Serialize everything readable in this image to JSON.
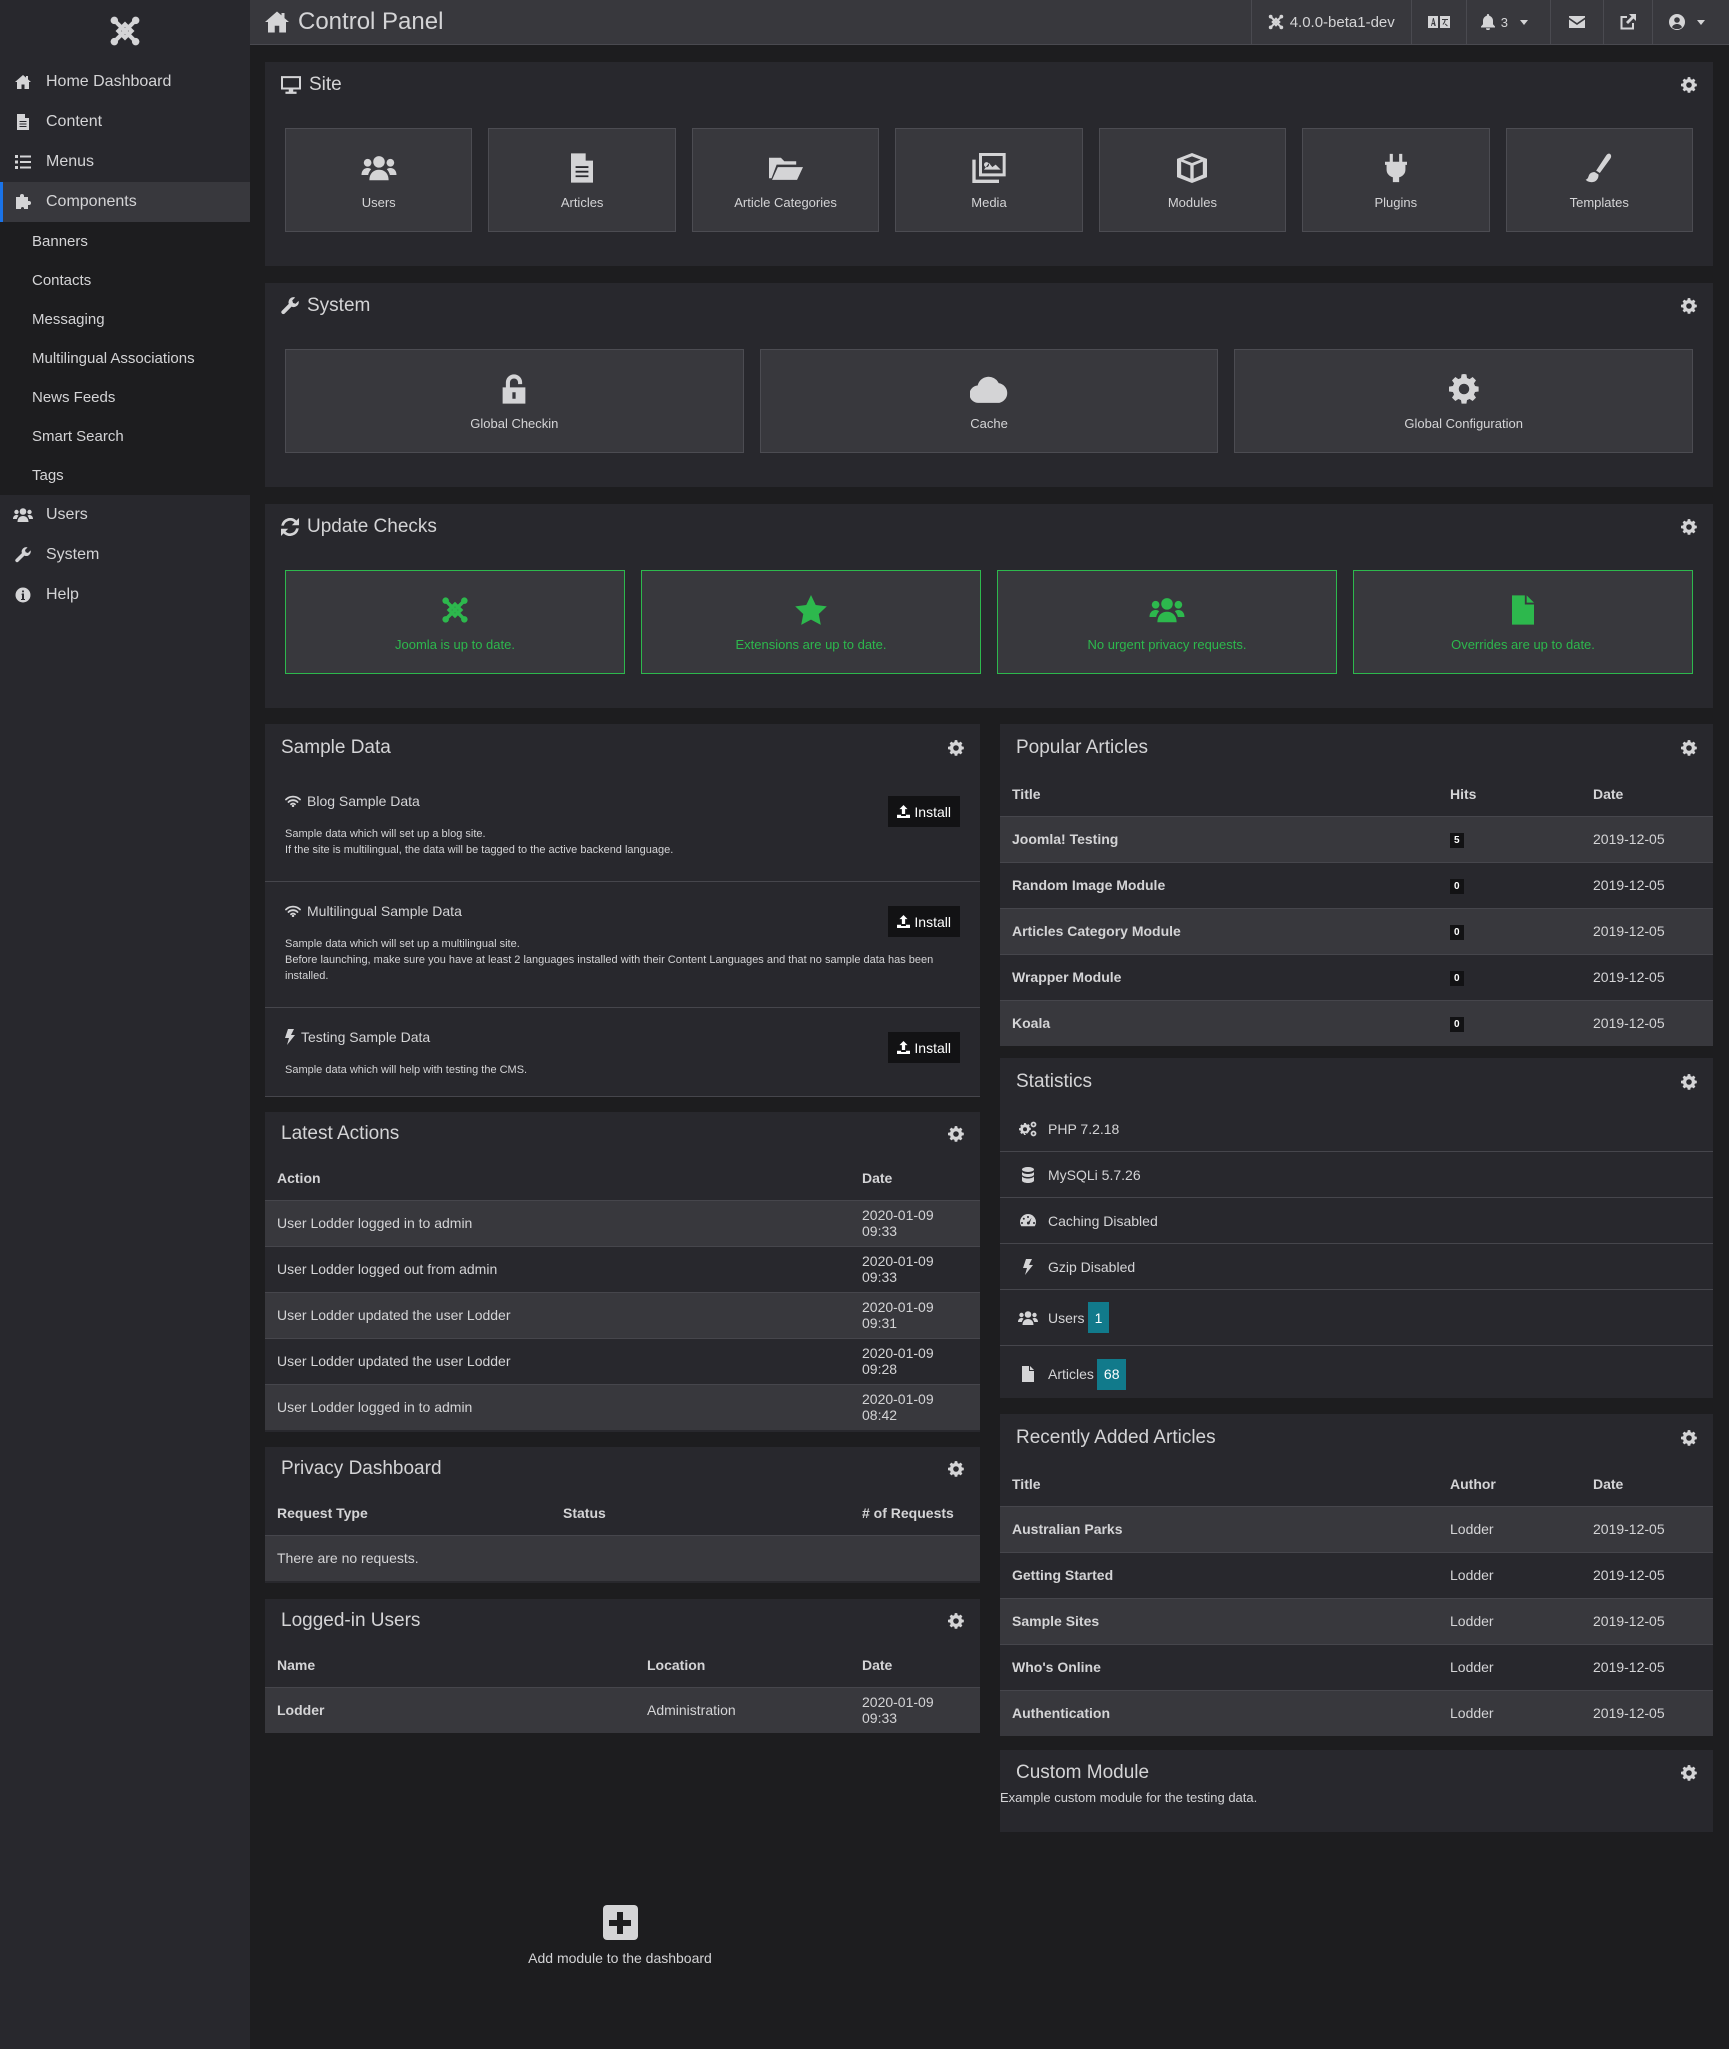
{
  "header": {
    "title": "Control Panel",
    "version": "4.0.0-beta1-dev",
    "notifications_count": "3"
  },
  "sidebar": {
    "items": [
      {
        "label": "Home Dashboard",
        "icon": "home-icon"
      },
      {
        "label": "Content",
        "icon": "file-icon"
      },
      {
        "label": "Menus",
        "icon": "list-icon"
      },
      {
        "label": "Components",
        "icon": "puzzle-icon",
        "active": true
      },
      {
        "label": "Users",
        "icon": "users-icon"
      },
      {
        "label": "System",
        "icon": "wrench-icon"
      },
      {
        "label": "Help",
        "icon": "info-icon"
      }
    ],
    "components_submenu": [
      "Banners",
      "Contacts",
      "Messaging",
      "Multilingual Associations",
      "News Feeds",
      "Smart Search",
      "Tags"
    ]
  },
  "site": {
    "title": "Site",
    "tiles": [
      "Users",
      "Articles",
      "Article Categories",
      "Media",
      "Modules",
      "Plugins",
      "Templates"
    ]
  },
  "system": {
    "title": "System",
    "tiles": [
      "Global Checkin",
      "Cache",
      "Global Configuration"
    ]
  },
  "update_checks": {
    "title": "Update Checks",
    "tiles": [
      "Joomla is up to date.",
      "Extensions are up to date.",
      "No urgent privacy requests.",
      "Overrides are up to date."
    ],
    "status_color": "#2db84d"
  },
  "sample_data": {
    "title": "Sample Data",
    "install_label": "Install",
    "items": [
      {
        "title": "Blog Sample Data",
        "desc": [
          "Sample data which will set up a blog site.",
          "If the site is multilingual, the data will be tagged to the active backend language."
        ]
      },
      {
        "title": "Multilingual Sample Data",
        "desc": [
          "Sample data which will set up a multilingual site.",
          "Before launching, make sure you have at least 2 languages installed with their Content Languages and that no sample data has been installed."
        ]
      },
      {
        "title": "Testing Sample Data",
        "desc": [
          "Sample data which will help with testing the CMS."
        ]
      }
    ]
  },
  "latest_actions": {
    "title": "Latest Actions",
    "columns": [
      "Action",
      "Date"
    ],
    "rows": [
      [
        "User Lodder logged in to admin",
        "2020-01-09 09:33"
      ],
      [
        "User Lodder logged out from admin",
        "2020-01-09 09:33"
      ],
      [
        "User Lodder updated the user Lodder",
        "2020-01-09 09:31"
      ],
      [
        "User Lodder updated the user Lodder",
        "2020-01-09 09:28"
      ],
      [
        "User Lodder logged in to admin",
        "2020-01-09 08:42"
      ]
    ]
  },
  "privacy_dashboard": {
    "title": "Privacy Dashboard",
    "columns": [
      "Request Type",
      "Status",
      "# of Requests"
    ],
    "empty": "There are no requests."
  },
  "logged_in_users": {
    "title": "Logged-in Users",
    "columns": [
      "Name",
      "Location",
      "Date"
    ],
    "rows": [
      [
        "Lodder",
        "Administration",
        "2020-01-09 09:33"
      ]
    ]
  },
  "popular_articles": {
    "title": "Popular Articles",
    "columns": [
      "Title",
      "Hits",
      "Date"
    ],
    "rows": [
      [
        "Joomla! Testing",
        "5",
        "2019-12-05"
      ],
      [
        "Random Image Module",
        "0",
        "2019-12-05"
      ],
      [
        "Articles Category Module",
        "0",
        "2019-12-05"
      ],
      [
        "Wrapper Module",
        "0",
        "2019-12-05"
      ],
      [
        "Koala",
        "0",
        "2019-12-05"
      ]
    ]
  },
  "statistics": {
    "title": "Statistics",
    "items": [
      {
        "label": "PHP 7.2.18",
        "icon": "cogs-icon"
      },
      {
        "label": "MySQLi 5.7.26",
        "icon": "database-icon"
      },
      {
        "label": "Caching Disabled",
        "icon": "tachometer-icon"
      },
      {
        "label": "Gzip Disabled",
        "icon": "bolt-icon"
      },
      {
        "label": "Users",
        "icon": "users-icon",
        "count": "1"
      },
      {
        "label": "Articles",
        "icon": "file-icon",
        "count": "68"
      }
    ],
    "badge_color": "#117a8b"
  },
  "recently_added": {
    "title": "Recently Added Articles",
    "columns": [
      "Title",
      "Author",
      "Date"
    ],
    "rows": [
      [
        "Australian Parks",
        "Lodder",
        "2019-12-05"
      ],
      [
        "Getting Started",
        "Lodder",
        "2019-12-05"
      ],
      [
        "Sample Sites",
        "Lodder",
        "2019-12-05"
      ],
      [
        "Who's Online",
        "Lodder",
        "2019-12-05"
      ],
      [
        "Authentication",
        "Lodder",
        "2019-12-05"
      ]
    ]
  },
  "custom_module": {
    "title": "Custom Module",
    "body": "Example custom module for the testing data."
  },
  "add_module": {
    "label": "Add module to the dashboard"
  },
  "colors": {
    "accent": "#1a73e8",
    "success": "#2db84d",
    "info_badge": "#117a8b"
  }
}
